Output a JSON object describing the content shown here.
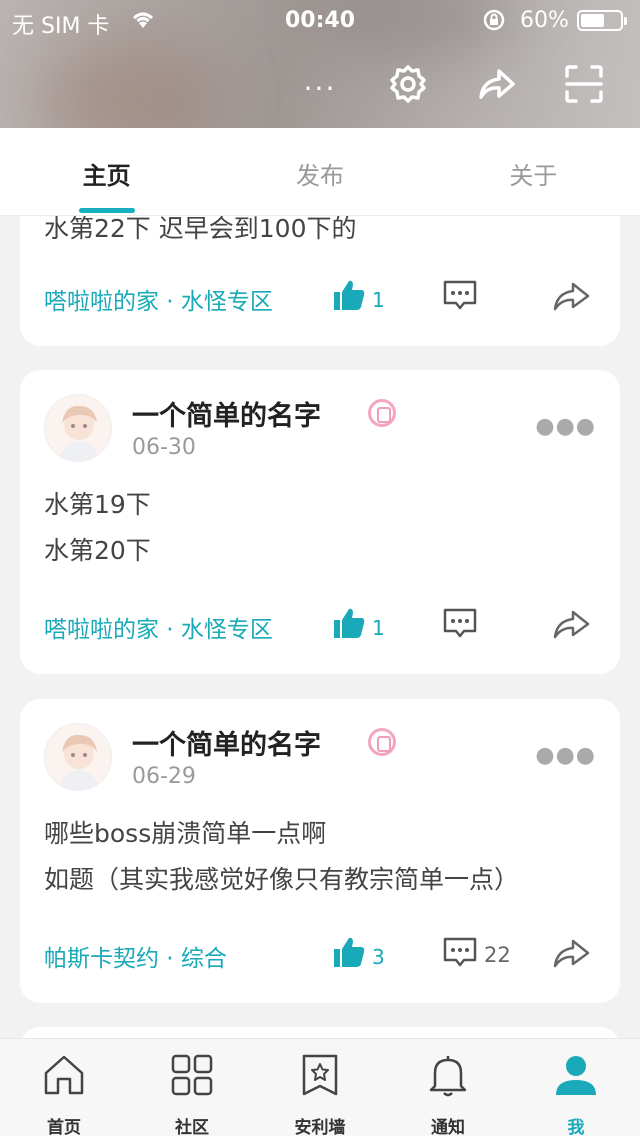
{
  "status_bar": {
    "carrier": "无 SIM 卡",
    "time": "00:40",
    "battery": "60%",
    "battery_level": 0.6
  },
  "header": {
    "more_label": "···"
  },
  "tabs": [
    {
      "label": "主页",
      "active": true
    },
    {
      "label": "发布",
      "active": false
    },
    {
      "label": "关于",
      "active": false
    }
  ],
  "posts": [
    {
      "text_lines": [
        "水第22下 迟早会到100下的"
      ],
      "tags": "嗒啦啦的家 · 水怪专区",
      "likes": "1",
      "comments": ""
    },
    {
      "author": "一个简单的名字",
      "date": "06-30",
      "text_lines": [
        "水第19下",
        "水第20下"
      ],
      "tags": "嗒啦啦的家 · 水怪专区",
      "likes": "1",
      "comments": ""
    },
    {
      "author": "一个简单的名字",
      "date": "06-29",
      "text_lines": [
        "哪些boss崩溃简单一点啊",
        "如题（其实我感觉好像只有教宗简单一点）"
      ],
      "tags": "帕斯卡契约 · 综合",
      "likes": "3",
      "comments": "22"
    }
  ],
  "bottom_nav": [
    {
      "label": "首页",
      "icon": "home-icon"
    },
    {
      "label": "社区",
      "icon": "grid-icon"
    },
    {
      "label": "安利墙",
      "icon": "bookmark-star-icon"
    },
    {
      "label": "通知",
      "icon": "bell-icon"
    },
    {
      "label": "我",
      "icon": "person-icon",
      "active": true
    }
  ],
  "colors": {
    "accent": "#19a9b8",
    "badge": "#f29db6"
  }
}
